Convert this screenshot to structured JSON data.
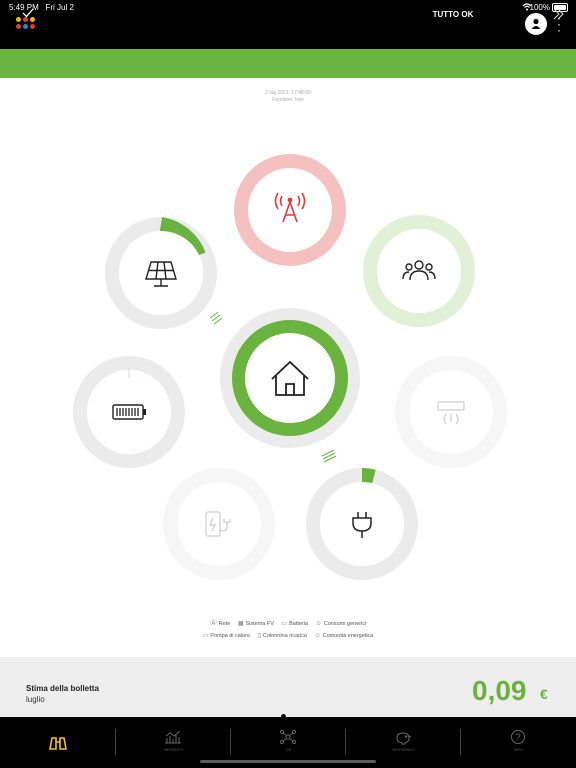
{
  "status_bar": {
    "time": "5:49 PM",
    "date": "Fri Jul 2",
    "battery": "100%"
  },
  "banner": {
    "text": "TUTTO OK",
    "color": "#6ab33e"
  },
  "meta": {
    "datetime": "2 lug 2021, 17:48:59",
    "supplier": "Fornitore: Iren"
  },
  "nodes": [
    {
      "name": "Rete",
      "icon": "grid-tower-icon",
      "state": "alert"
    },
    {
      "name": "Sistema FV",
      "icon": "solar-panel-icon",
      "level": 0.2
    },
    {
      "name": "Consumi generici",
      "icon": "people-icon",
      "state": "active-light"
    },
    {
      "name": "Casa",
      "icon": "house-icon",
      "level": 1.0
    },
    {
      "name": "Batteria",
      "icon": "battery-icon",
      "level": 0.0
    },
    {
      "name": "Pompa di calore",
      "icon": "heat-pump-icon",
      "state": "disabled"
    },
    {
      "name": "Colonnina ricarica",
      "icon": "ev-charger-icon",
      "state": "disabled"
    },
    {
      "name": "Presa",
      "icon": "plug-icon",
      "level": 0.04
    }
  ],
  "legend": {
    "row1": [
      "Rete",
      "Sistema FV",
      "Batteria",
      "Consumi generici"
    ],
    "row2": [
      "Pompa di calore",
      "Colonnina ricarica",
      "Comunità energetica"
    ]
  },
  "bill": {
    "title": "Stima della bolletta",
    "month": "luglio",
    "value": "0,09",
    "currency": "€"
  },
  "nav": [
    {
      "label": "",
      "icon": "binoculars-icon",
      "active": true
    },
    {
      "label": "IMPIANTO",
      "icon": "chart-icon",
      "active": false
    },
    {
      "label": "CE",
      "icon": "network-icon",
      "active": false
    },
    {
      "label": "RISPARMIO",
      "icon": "piggy-bank-icon",
      "active": false
    },
    {
      "label": "INFO",
      "icon": "help-icon",
      "active": false
    }
  ],
  "colors": {
    "green": "#6ab33e",
    "alert": "#f4c0c0",
    "alert_icon": "#e53935",
    "ring_grey": "#ebebeb"
  }
}
